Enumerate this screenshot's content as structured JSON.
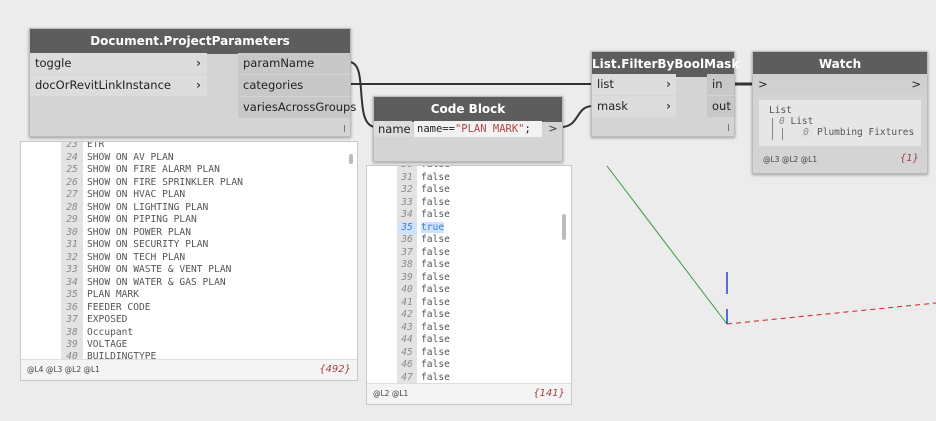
{
  "project_params": {
    "title": "Document.ProjectParameters",
    "inputs": [
      "toggle",
      "docOrRevitLinkInstance"
    ],
    "outputs": [
      "paramName",
      "categories",
      "variesAcrossGroups"
    ],
    "preview": {
      "partial_top": "23",
      "partial_top_text": "ETR",
      "items": [
        {
          "i": "24",
          "t": "SHOW ON AV PLAN"
        },
        {
          "i": "25",
          "t": "SHOW ON FIRE ALARM PLAN"
        },
        {
          "i": "26",
          "t": "SHOW ON FIRE SPRINKLER PLAN"
        },
        {
          "i": "27",
          "t": "SHOW ON HVAC PLAN"
        },
        {
          "i": "28",
          "t": "SHOW ON LIGHTING PLAN"
        },
        {
          "i": "29",
          "t": "SHOW ON PIPING PLAN"
        },
        {
          "i": "30",
          "t": "SHOW ON POWER PLAN"
        },
        {
          "i": "31",
          "t": "SHOW ON SECURITY PLAN"
        },
        {
          "i": "32",
          "t": "SHOW ON TECH PLAN"
        },
        {
          "i": "33",
          "t": "SHOW ON WASTE & VENT PLAN"
        },
        {
          "i": "34",
          "t": "SHOW ON WATER & GAS PLAN"
        },
        {
          "i": "35",
          "t": "PLAN MARK"
        },
        {
          "i": "36",
          "t": "FEEDER CODE"
        },
        {
          "i": "37",
          "t": "EXPOSED"
        },
        {
          "i": "38",
          "t": "Occupant"
        },
        {
          "i": "39",
          "t": "VOLTAGE"
        }
      ],
      "partial_bottom": "40",
      "partial_bottom_text": "BUILDINGTYPE",
      "levels": "@L4 @L3 @L2 @L1",
      "count": "{492}"
    }
  },
  "code_block": {
    "title": "Code Block",
    "input": "name",
    "code_prefix": "name==",
    "code_string": "\"PLAN MARK\"",
    "code_suffix": ";",
    "output_chevron": ">",
    "preview": {
      "items": [
        {
          "i": "31",
          "t": "false"
        },
        {
          "i": "32",
          "t": "false"
        },
        {
          "i": "33",
          "t": "false"
        },
        {
          "i": "34",
          "t": "false"
        },
        {
          "i": "35",
          "t": "true"
        },
        {
          "i": "36",
          "t": "false"
        },
        {
          "i": "37",
          "t": "false"
        },
        {
          "i": "38",
          "t": "false"
        },
        {
          "i": "39",
          "t": "false"
        },
        {
          "i": "40",
          "t": "false"
        },
        {
          "i": "41",
          "t": "false"
        },
        {
          "i": "42",
          "t": "false"
        },
        {
          "i": "43",
          "t": "false"
        },
        {
          "i": "44",
          "t": "false"
        },
        {
          "i": "45",
          "t": "false"
        },
        {
          "i": "46",
          "t": "false"
        },
        {
          "i": "47",
          "t": "false"
        }
      ],
      "levels": "@L2 @L1",
      "count": "{141}"
    }
  },
  "filter": {
    "title": "List.FilterByBoolMask",
    "inputs": [
      "list",
      "mask"
    ],
    "outputs": [
      "in",
      "out"
    ]
  },
  "watch": {
    "title": "Watch",
    "input": ">",
    "output": ">",
    "tree_root": "List",
    "tree_child_index": "0",
    "tree_child": "List",
    "tree_leaf_index": "0",
    "tree_leaf": "Plumbing Fixtures",
    "levels": "@L3 @L2 @L1",
    "count": "{1}"
  },
  "colors": {
    "title_bar": "#5d5d5d",
    "node_body": "#d4d4d4",
    "wire": "#333333",
    "count": "#a04040"
  }
}
